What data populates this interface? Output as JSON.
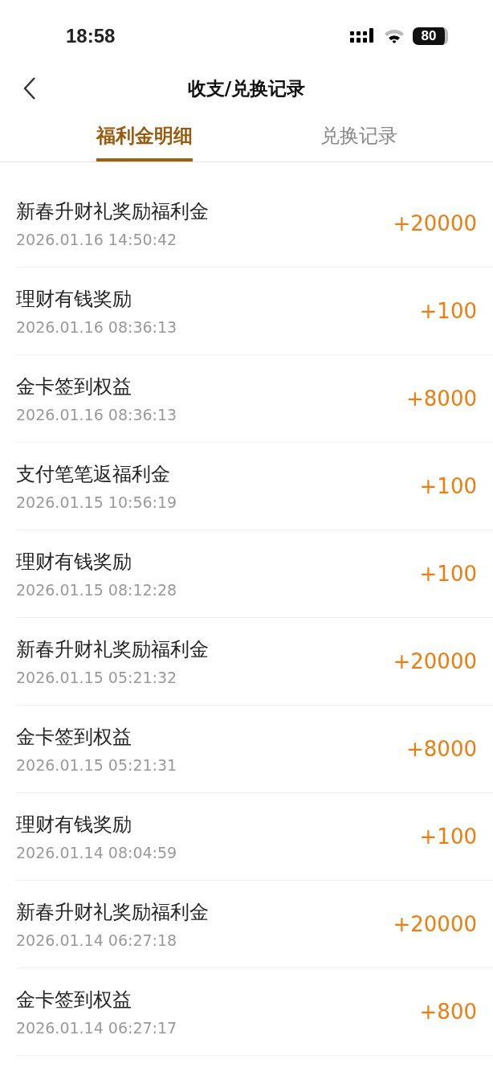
{
  "status_bar": {
    "time": "18:58",
    "battery": "80"
  },
  "header": {
    "title": "收支/兑换记录"
  },
  "tabs": [
    {
      "label": "福利金明细",
      "selected": true
    },
    {
      "label": "兑换记录",
      "selected": false
    }
  ],
  "records": [
    {
      "title": "新春升财礼奖励福利金",
      "time": "2026.01.16 14:50:42",
      "amount": "+20000"
    },
    {
      "title": "理财有钱奖励",
      "time": "2026.01.16 08:36:13",
      "amount": "+100"
    },
    {
      "title": "金卡签到权益",
      "time": "2026.01.16 08:36:13",
      "amount": "+8000"
    },
    {
      "title": "支付笔笔返福利金",
      "time": "2026.01.15 10:56:19",
      "amount": "+100"
    },
    {
      "title": "理财有钱奖励",
      "time": "2026.01.15 08:12:28",
      "amount": "+100"
    },
    {
      "title": "新春升财礼奖励福利金",
      "time": "2026.01.15 05:21:32",
      "amount": "+20000"
    },
    {
      "title": "金卡签到权益",
      "time": "2026.01.15 05:21:31",
      "amount": "+8000"
    },
    {
      "title": "理财有钱奖励",
      "time": "2026.01.14 08:04:59",
      "amount": "+100"
    },
    {
      "title": "新春升财礼奖励福利金",
      "time": "2026.01.14 06:27:18",
      "amount": "+20000"
    },
    {
      "title": "金卡签到权益",
      "time": "2026.01.14 06:27:17",
      "amount": "+800"
    }
  ]
}
